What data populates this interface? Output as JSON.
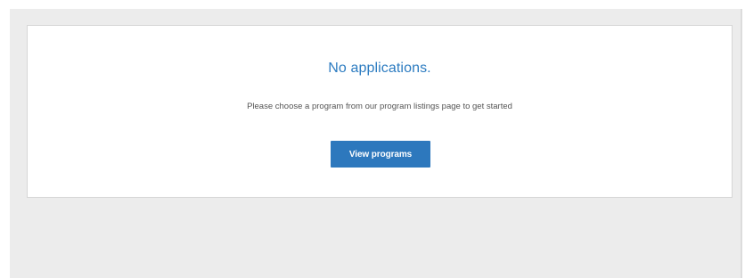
{
  "empty_state": {
    "title": "No applications.",
    "message": "Please choose a program from our program listings page to get started",
    "button_label": "View programs"
  }
}
